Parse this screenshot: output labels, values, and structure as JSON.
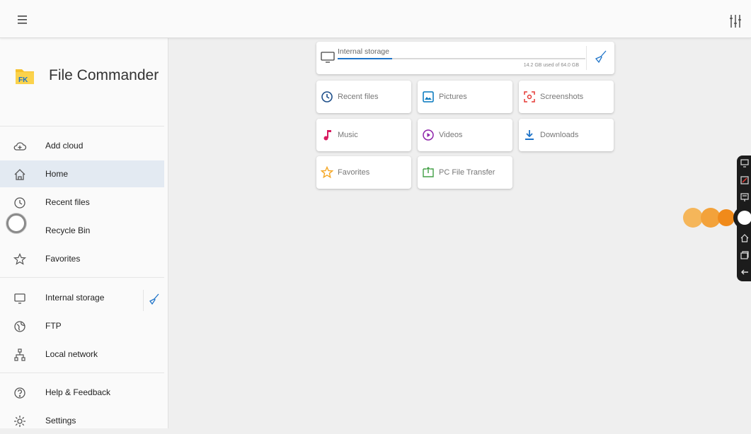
{
  "app": {
    "name": "File Commander",
    "logo_text": "FK"
  },
  "topbar": {
    "menu_icon": "hamburger-menu-icon",
    "filter_icon": "filter-settings-icon"
  },
  "sidebar": {
    "items": [
      {
        "label": "Add cloud",
        "icon": "cloud-add-icon"
      },
      {
        "label": "Home",
        "icon": "home-icon",
        "active": true
      },
      {
        "label": "Recent files",
        "icon": "clock-icon"
      },
      {
        "label": "Recycle Bin",
        "icon": "recycle-bin-icon"
      },
      {
        "label": "Favorites",
        "icon": "star-icon"
      },
      {
        "label": "Internal storage",
        "icon": "monitor-icon"
      },
      {
        "label": "FTP",
        "icon": "globe-icon"
      },
      {
        "label": "Local network",
        "icon": "network-icon"
      },
      {
        "label": "Help & Feedback",
        "icon": "help-icon"
      },
      {
        "label": "Settings",
        "icon": "gear-icon"
      }
    ],
    "clean_icon": "broom-icon"
  },
  "storage": {
    "title": "Internal storage",
    "used_text": "14.2 GB used of 64.0 GB",
    "used_fraction": 0.22
  },
  "tiles": {
    "recent_files": "Recent files",
    "pictures": "Pictures",
    "screenshots": "Screenshots",
    "music": "Music",
    "videos": "Videos",
    "downloads": "Downloads",
    "favorites": "Favorites",
    "pc_transfer": "PC File Transfer"
  },
  "colors": {
    "accent": "#1e73c8",
    "logo_folder": "#f6c12b",
    "active_nav": "#e3eaf2",
    "music": "#d81b60",
    "videos": "#8e24aa",
    "downloads": "#1e73c8",
    "pictures": "#0277bd",
    "screenshots": "#e53935",
    "pc_transfer": "#43a047",
    "favorites": "#f5a623",
    "bubble": "#f5a93b"
  }
}
